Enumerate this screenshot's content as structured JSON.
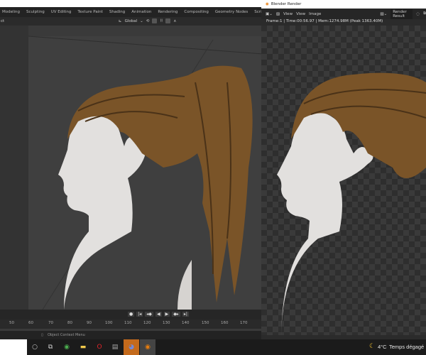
{
  "main": {
    "tabs": [
      "Modeling",
      "Sculpting",
      "UV Editing",
      "Texture Paint",
      "Shading",
      "Animation",
      "Rendering",
      "Compositing",
      "Geometry Nodes",
      "Scripting",
      "+"
    ],
    "header": {
      "left_label": "ct",
      "orientation": "Global"
    },
    "ruler": [
      "50",
      "60",
      "70",
      "80",
      "90",
      "100",
      "110",
      "120",
      "130",
      "140",
      "150",
      "160",
      "170"
    ],
    "status": "Object Context Menu"
  },
  "render_window": {
    "title": "Blender Render",
    "menu": [
      "View",
      "View",
      "Image"
    ],
    "slot": "Render Result",
    "info": "Frame:1 | Time:00:56.97 | Mem:1274.98M (Peak 1363.40M)"
  },
  "taskbar": {
    "weather_temp": "4°C",
    "weather_text": "Temps dégagé"
  },
  "colors": {
    "hair": "#7a5428",
    "skin": "#e4e2e0",
    "accent": "#e87d0d"
  }
}
